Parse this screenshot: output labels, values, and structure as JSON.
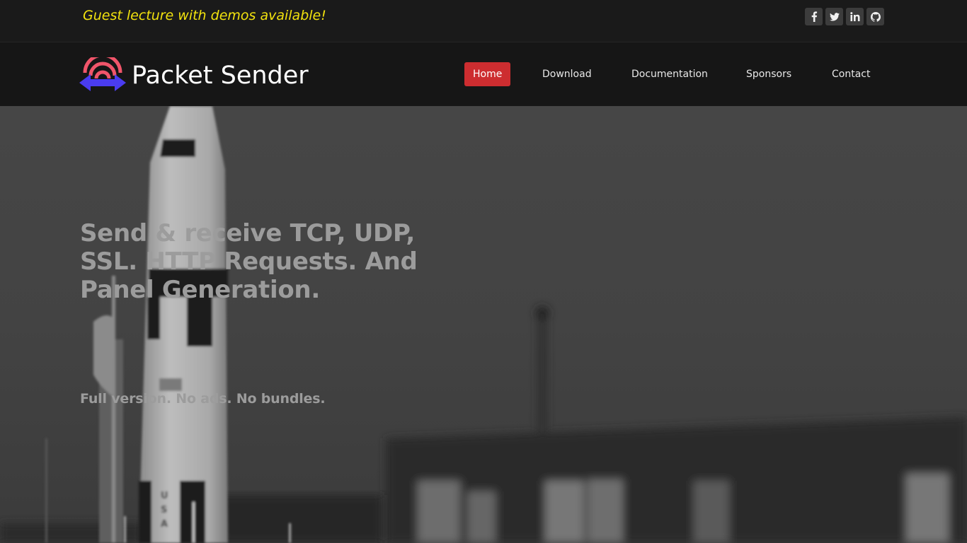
{
  "topbar": {
    "announcement": "Guest lecture with demos available!",
    "announcement_color": "#f2e20e",
    "social": [
      {
        "name": "facebook",
        "icon": "facebook-icon",
        "glyph": "f"
      },
      {
        "name": "twitter",
        "icon": "twitter-icon",
        "glyph": "twitter-bird"
      },
      {
        "name": "linkedin",
        "icon": "linkedin-icon",
        "glyph": "in"
      },
      {
        "name": "github",
        "icon": "github-icon",
        "glyph": "github-octocat"
      }
    ]
  },
  "header": {
    "brand_name": "Packet Sender",
    "logo_colors": {
      "waves": "#f1556a",
      "arrow": "#4a3cf0"
    },
    "nav": [
      {
        "label": "Home",
        "active": true
      },
      {
        "label": "Download",
        "active": false
      },
      {
        "label": "Documentation",
        "active": false
      },
      {
        "label": "Sponsors",
        "active": false
      },
      {
        "label": "Contact",
        "active": false
      }
    ],
    "active_color": "#cd2d30"
  },
  "hero": {
    "title": "Send & receive TCP, UDP, SSL. HTTP Requests. And Panel Generation.",
    "subtitle": "Full version. No ads. No bundles.",
    "background": "rocket-photo-grayscale"
  }
}
